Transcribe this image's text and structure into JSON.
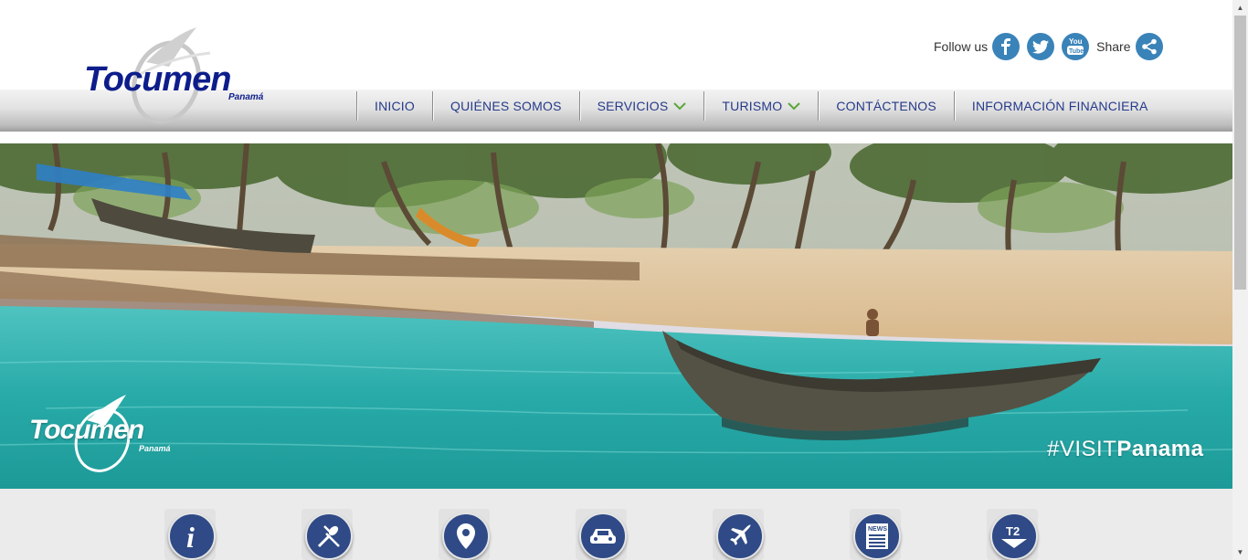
{
  "header": {
    "logo": {
      "name": "Tocumen",
      "sub": "Panamá"
    },
    "social": {
      "follow_label": "Follow us",
      "share_label": "Share",
      "icons": [
        "facebook-icon",
        "twitter-icon",
        "youtube-icon",
        "share-icon"
      ]
    }
  },
  "nav": {
    "items": [
      {
        "label": "INICIO",
        "dropdown": false
      },
      {
        "label": "QUIÉNES SOMOS",
        "dropdown": false
      },
      {
        "label": "SERVICIOS",
        "dropdown": true
      },
      {
        "label": "TURISMO",
        "dropdown": true
      },
      {
        "label": "CONTÁCTENOS",
        "dropdown": false
      },
      {
        "label": "INFORMACIÓN FINANCIERA",
        "dropdown": false
      }
    ]
  },
  "banner": {
    "logo": {
      "name": "Tocumen",
      "sub": "Panamá"
    },
    "hashtag_prefix": "#VISIT",
    "hashtag_name": "Panama"
  },
  "quick_icons": [
    {
      "icon": "info-icon"
    },
    {
      "icon": "restaurant-icon"
    },
    {
      "icon": "location-pin-icon"
    },
    {
      "icon": "car-icon"
    },
    {
      "icon": "airplane-icon"
    },
    {
      "icon": "news-icon",
      "text": "NEWS"
    },
    {
      "icon": "terminal-2-icon",
      "text": "T2"
    }
  ],
  "colors": {
    "brand_blue": "#0d1d8b",
    "nav_text": "#253a8a",
    "social_blue": "#3a83b9",
    "icon_blue": "#2f4a86",
    "chevron_green": "#5aa63a"
  }
}
